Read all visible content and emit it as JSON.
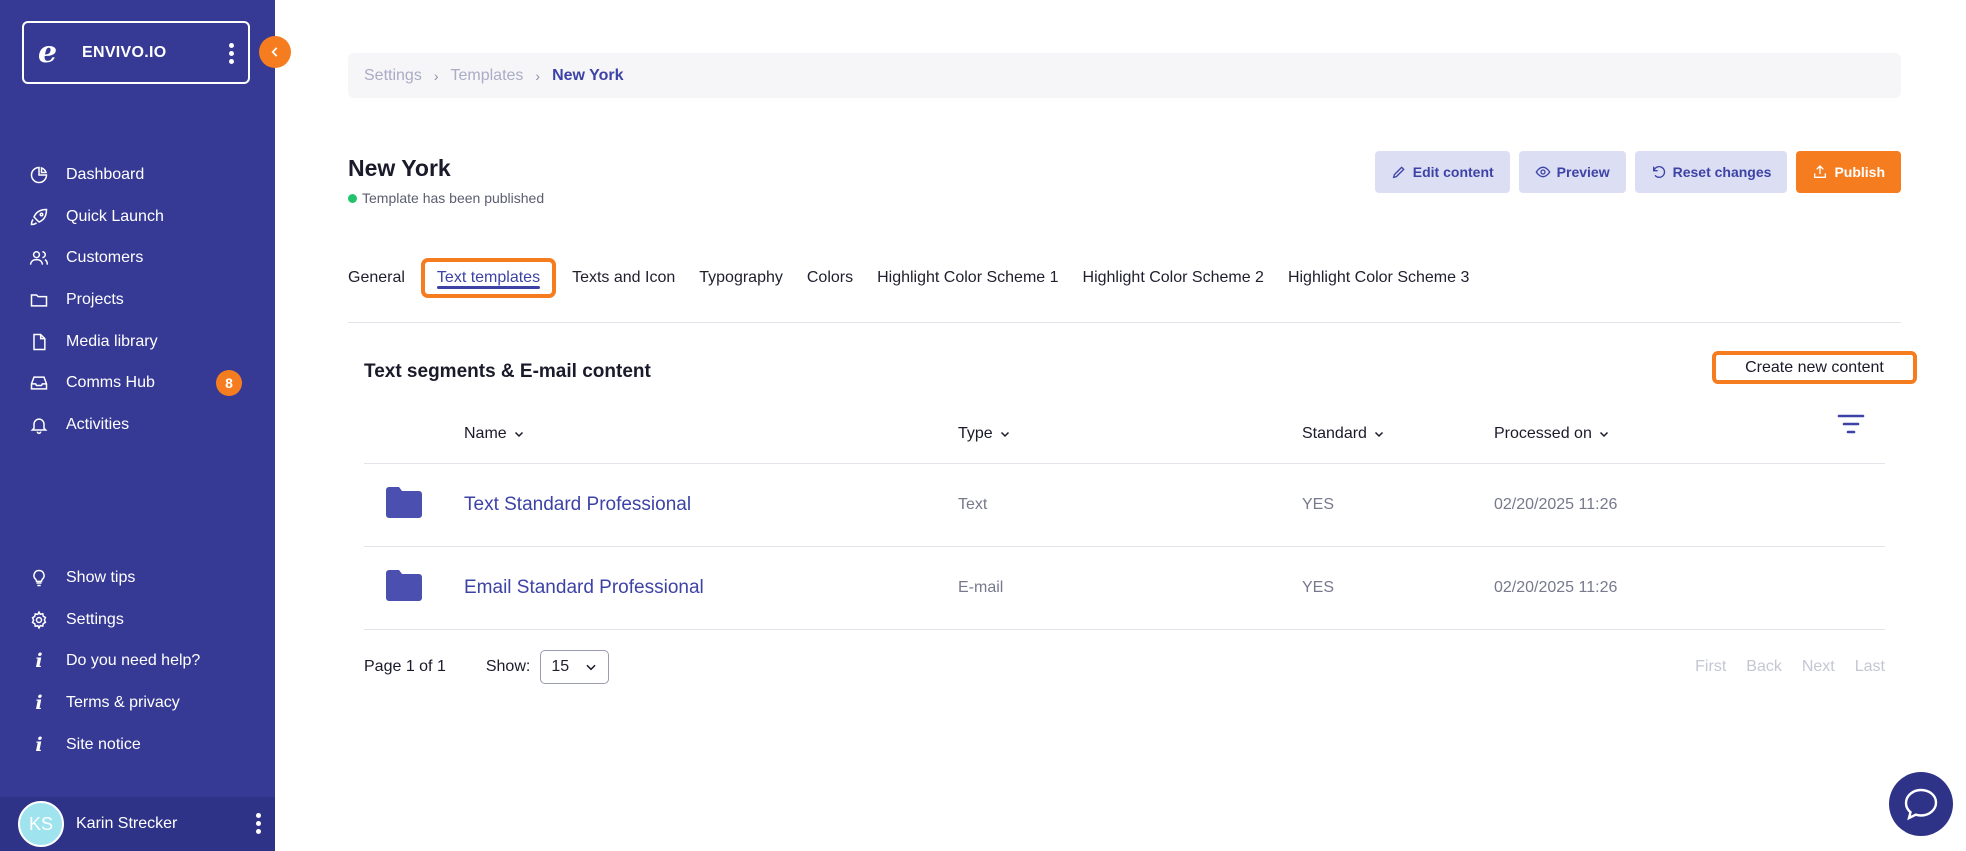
{
  "sidebar": {
    "brand_logo": "e",
    "brand_name": "ENVIVO.IO",
    "nav_top": [
      {
        "label": "Dashboard",
        "icon": "pie-chart-icon"
      },
      {
        "label": "Quick Launch",
        "icon": "rocket-icon"
      },
      {
        "label": "Customers",
        "icon": "users-icon"
      },
      {
        "label": "Projects",
        "icon": "folder-icon"
      },
      {
        "label": "Media library",
        "icon": "file-icon"
      },
      {
        "label": "Comms Hub",
        "icon": "inbox-icon",
        "badge": "8"
      },
      {
        "label": "Activities",
        "icon": "bell-icon"
      }
    ],
    "nav_bottom": [
      {
        "label": "Show tips",
        "icon": "lightbulb-icon"
      },
      {
        "label": "Settings",
        "icon": "gear-icon"
      },
      {
        "label": "Do you need help?",
        "icon": "info-icon"
      },
      {
        "label": "Terms & privacy",
        "icon": "info-icon"
      },
      {
        "label": "Site notice",
        "icon": "info-icon"
      }
    ],
    "user": {
      "initials": "KS",
      "name": "Karin Strecker"
    }
  },
  "breadcrumb": [
    "Settings",
    "Templates",
    "New York"
  ],
  "page": {
    "title": "New York",
    "status": "Template has been published"
  },
  "actions": {
    "edit": "Edit content",
    "preview": "Preview",
    "reset": "Reset changes",
    "publish": "Publish"
  },
  "tabs": [
    {
      "label": "General"
    },
    {
      "label": "Text templates",
      "active": true
    },
    {
      "label": "Texts and Icon"
    },
    {
      "label": "Typography"
    },
    {
      "label": "Colors"
    },
    {
      "label": "Highlight Color Scheme 1"
    },
    {
      "label": "Highlight Color Scheme 2"
    },
    {
      "label": "Highlight Color Scheme 3"
    }
  ],
  "section": {
    "title": "Text segments & E-mail content",
    "create_label": "Create new content"
  },
  "table": {
    "columns": [
      "Name",
      "Type",
      "Standard",
      "Processed on"
    ],
    "rows": [
      {
        "name": "Text Standard Professional",
        "type": "Text",
        "standard": "YES",
        "processed": "02/20/2025 11:26"
      },
      {
        "name": "Email Standard Professional",
        "type": "E-mail",
        "standard": "YES",
        "processed": "02/20/2025 11:26"
      }
    ]
  },
  "pager": {
    "page_info": "Page 1 of 1",
    "show_label": "Show:",
    "show_value": "15",
    "first": "First",
    "back": "Back",
    "next": "Next",
    "last": "Last"
  },
  "colors": {
    "sidebar": "#363a94",
    "accent": "#f57c1f",
    "link": "#3d43a6",
    "status_ok": "#22c36a"
  }
}
